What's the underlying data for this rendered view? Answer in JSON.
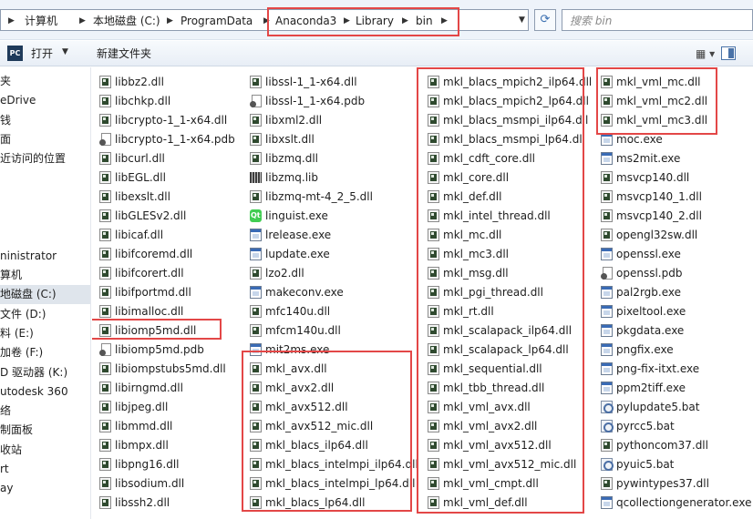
{
  "address": {
    "crumbs": [
      "计算机",
      "本地磁盘 (C:)",
      "ProgramData",
      "Anaconda3",
      "Library",
      "bin"
    ]
  },
  "search": {
    "placeholder": "搜索 bin"
  },
  "toolbar": {
    "open_label": "打开",
    "new_folder_label": "新建文件夹"
  },
  "nav": {
    "items": [
      "夹",
      "eDrive",
      "钱",
      "面",
      "近访问的位置",
      "",
      "",
      "",
      "",
      "ninistrator",
      "算机",
      "地磁盘 (C:)",
      "文件 (D:)",
      "料 (E:)",
      "加卷 (F:)",
      "D 驱动器 (K:)",
      "utodesk 360",
      "络",
      "制面板",
      "收站",
      "rt",
      "ay"
    ],
    "selected_index": 11
  },
  "files": {
    "col1": [
      "libbz2.dll",
      "libchkp.dll",
      "libcrypto-1_1-x64.dll",
      "libcrypto-1_1-x64.pdb",
      "libcurl.dll",
      "libEGL.dll",
      "libexslt.dll",
      "libGLESv2.dll",
      "libicaf.dll",
      "libifcoremd.dll",
      "libifcorert.dll",
      "libifportmd.dll",
      "libimalloc.dll",
      "libiomp5md.dll",
      "libiomp5md.pdb",
      "libiompstubs5md.dll",
      "libirngmd.dll",
      "libjpeg.dll",
      "libmmd.dll",
      "libmpx.dll",
      "libpng16.dll",
      "libsodium.dll",
      "libssh2.dll"
    ],
    "col2": [
      "libssl-1_1-x64.dll",
      "libssl-1_1-x64.pdb",
      "libxml2.dll",
      "libxslt.dll",
      "libzmq.dll",
      "libzmq.lib",
      "libzmq-mt-4_2_5.dll",
      "linguist.exe",
      "lrelease.exe",
      "lupdate.exe",
      "lzo2.dll",
      "makeconv.exe",
      "mfc140u.dll",
      "mfcm140u.dll",
      "mit2ms.exe",
      "mkl_avx.dll",
      "mkl_avx2.dll",
      "mkl_avx512.dll",
      "mkl_avx512_mic.dll",
      "mkl_blacs_ilp64.dll",
      "mkl_blacs_intelmpi_ilp64.dll",
      "mkl_blacs_intelmpi_lp64.dll",
      "mkl_blacs_lp64.dll"
    ],
    "col3": [
      "mkl_blacs_mpich2_ilp64.dll",
      "mkl_blacs_mpich2_lp64.dll",
      "mkl_blacs_msmpi_ilp64.dll",
      "mkl_blacs_msmpi_lp64.dll",
      "mkl_cdft_core.dll",
      "mkl_core.dll",
      "mkl_def.dll",
      "mkl_intel_thread.dll",
      "mkl_mc.dll",
      "mkl_mc3.dll",
      "mkl_msg.dll",
      "mkl_pgi_thread.dll",
      "mkl_rt.dll",
      "mkl_scalapack_ilp64.dll",
      "mkl_scalapack_lp64.dll",
      "mkl_sequential.dll",
      "mkl_tbb_thread.dll",
      "mkl_vml_avx.dll",
      "mkl_vml_avx2.dll",
      "mkl_vml_avx512.dll",
      "mkl_vml_avx512_mic.dll",
      "mkl_vml_cmpt.dll",
      "mkl_vml_def.dll"
    ],
    "col4": [
      "mkl_vml_mc.dll",
      "mkl_vml_mc2.dll",
      "mkl_vml_mc3.dll",
      "moc.exe",
      "ms2mit.exe",
      "msvcp140.dll",
      "msvcp140_1.dll",
      "msvcp140_2.dll",
      "opengl32sw.dll",
      "openssl.exe",
      "openssl.pdb",
      "pal2rgb.exe",
      "pixeltool.exe",
      "pkgdata.exe",
      "pngfix.exe",
      "png-fix-itxt.exe",
      "ppm2tiff.exe",
      "pylupdate5.bat",
      "pyrcc5.bat",
      "pythoncom37.dll",
      "pyuic5.bat",
      "pywintypes37.dll",
      "qcollectiongenerator.exe"
    ]
  },
  "colors": {
    "annotation": "#e34747",
    "nav_selected": "#dfe5ec",
    "chrome": "#eef3fa"
  }
}
